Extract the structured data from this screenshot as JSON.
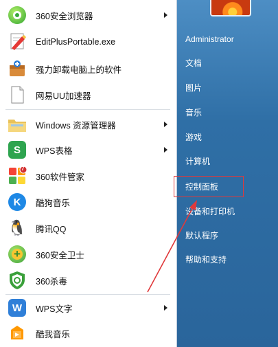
{
  "left_items": [
    {
      "label": "360安全浏览器",
      "icon": "360-browser-icon",
      "has_submenu": true
    },
    {
      "label": "EditPlusPortable.exe",
      "icon": "editplus-icon",
      "has_submenu": false
    },
    {
      "label": "强力卸载电脑上的软件",
      "icon": "uninstaller-icon",
      "has_submenu": false
    },
    {
      "label": "网易UU加速器",
      "icon": "document-icon",
      "has_submenu": false
    },
    {
      "label": "Windows 资源管理器",
      "icon": "explorer-folder-icon",
      "has_submenu": true
    },
    {
      "label": "WPS表格",
      "icon": "wps-spreadsheet-icon",
      "has_submenu": true
    },
    {
      "label": "360软件管家",
      "icon": "360-software-manager-icon",
      "has_submenu": false
    },
    {
      "label": "酷狗音乐",
      "icon": "kugou-icon",
      "has_submenu": false
    },
    {
      "label": "腾讯QQ",
      "icon": "qq-penguin-icon",
      "has_submenu": false
    },
    {
      "label": "360安全卫士",
      "icon": "360-safeguard-icon",
      "has_submenu": false
    },
    {
      "label": "360杀毒",
      "icon": "360-antivirus-icon",
      "has_submenu": false
    },
    {
      "label": "WPS文字",
      "icon": "wps-writer-icon",
      "has_submenu": true
    },
    {
      "label": "酷我音乐",
      "icon": "kuwo-icon",
      "has_submenu": false
    }
  ],
  "right_items": [
    {
      "label": "Administrator"
    },
    {
      "label": "文档"
    },
    {
      "label": "图片"
    },
    {
      "label": "音乐"
    },
    {
      "label": "游戏"
    },
    {
      "label": "计算机"
    },
    {
      "label": "控制面板"
    },
    {
      "label": "设备和打印机"
    },
    {
      "label": "默认程序"
    },
    {
      "label": "帮助和支持"
    }
  ],
  "glyphs": {
    "kugou": "K",
    "wps_sheet": "S",
    "wps_writer": "W",
    "qq": "🐧",
    "plus": "+",
    "badge7": "7"
  },
  "colors": {
    "highlight": "#e0393b",
    "right_pane": "#2f6fa6"
  }
}
